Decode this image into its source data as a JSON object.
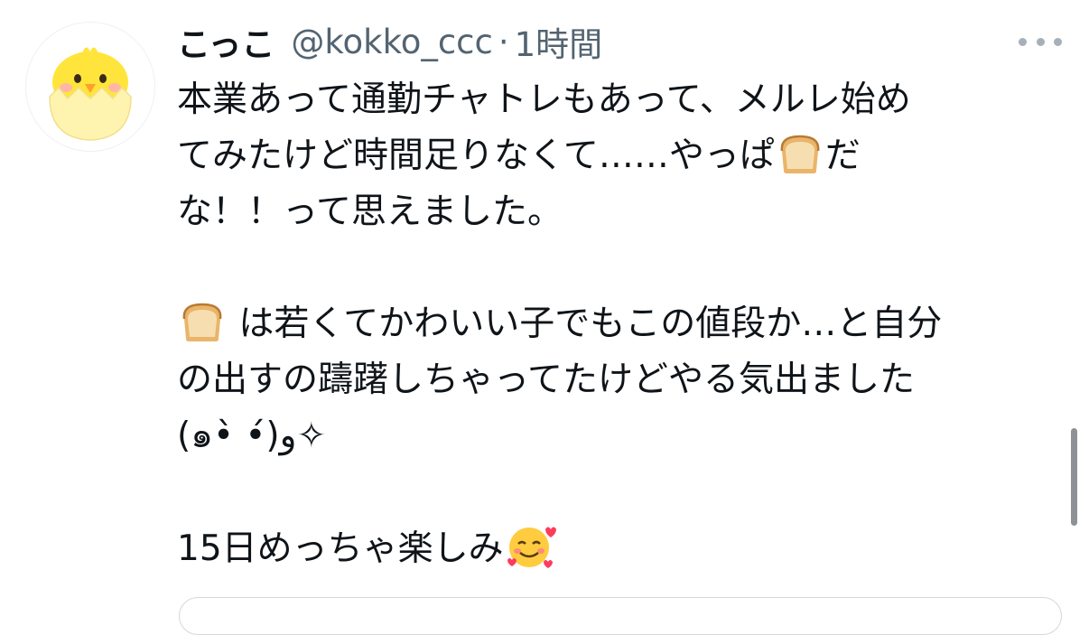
{
  "tweet": {
    "display_name": "こっこ",
    "handle": "@kokko_ccc",
    "separator": "·",
    "timestamp": "1時間",
    "lines": [
      "本業あって通勤チャトレもあって、メルレ始め",
      "てみたけど時間足りなくて……やっぱ",
      "だ",
      "な！！って思えました。",
      "は若くてかわいい子でもこの値段か…と自分",
      "の出すの躊躇しちゃってたけどやる気出ました",
      "(๑•̀ •́)و✧",
      "15日めっちゃ楽しみ"
    ]
  },
  "icons": {
    "avatar": "chick-in-eggshell-icon",
    "more": "more-options-icon",
    "bread": "bread-emoji",
    "smile": "smiling-face-with-hearts-emoji"
  },
  "colors": {
    "text": "#0f1419",
    "secondary": "#536471",
    "chick": "#ffe53b",
    "shell": "#fff3b0"
  }
}
